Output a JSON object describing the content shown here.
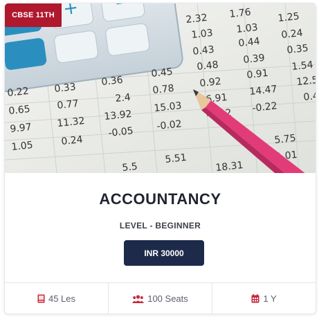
{
  "badge": {
    "label": "CBSE 11TH"
  },
  "course": {
    "title": "ACCOUNTANCY",
    "level": "LEVEL - BEGINNER",
    "price_label": "INR 30000"
  },
  "stats": [
    {
      "icon": "book-icon",
      "text": "45 Les"
    },
    {
      "icon": "users-icon",
      "text": "100 Seats"
    },
    {
      "icon": "calendar-icon",
      "text": "1 Y"
    }
  ],
  "colors": {
    "badge": "#b0182d",
    "button": "#1d2a4a",
    "icon_red": "#c9283c",
    "pencil": "#e23c78"
  }
}
